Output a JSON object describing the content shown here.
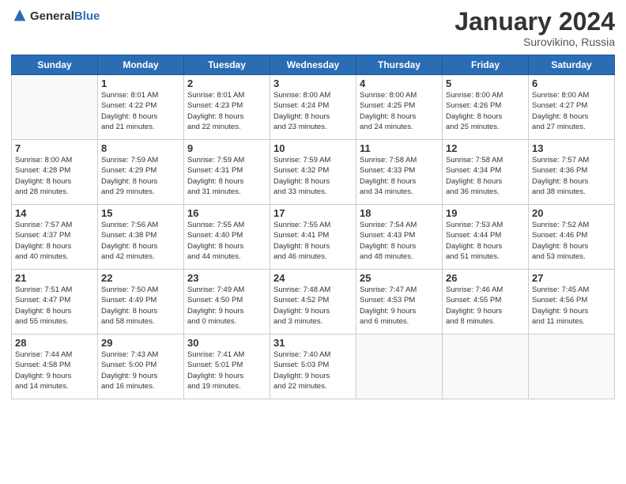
{
  "header": {
    "logo_general": "General",
    "logo_blue": "Blue",
    "month_title": "January 2024",
    "location": "Surovikino, Russia"
  },
  "days_of_week": [
    "Sunday",
    "Monday",
    "Tuesday",
    "Wednesday",
    "Thursday",
    "Friday",
    "Saturday"
  ],
  "weeks": [
    [
      {
        "day": "",
        "info": ""
      },
      {
        "day": "1",
        "info": "Sunrise: 8:01 AM\nSunset: 4:22 PM\nDaylight: 8 hours\nand 21 minutes."
      },
      {
        "day": "2",
        "info": "Sunrise: 8:01 AM\nSunset: 4:23 PM\nDaylight: 8 hours\nand 22 minutes."
      },
      {
        "day": "3",
        "info": "Sunrise: 8:00 AM\nSunset: 4:24 PM\nDaylight: 8 hours\nand 23 minutes."
      },
      {
        "day": "4",
        "info": "Sunrise: 8:00 AM\nSunset: 4:25 PM\nDaylight: 8 hours\nand 24 minutes."
      },
      {
        "day": "5",
        "info": "Sunrise: 8:00 AM\nSunset: 4:26 PM\nDaylight: 8 hours\nand 25 minutes."
      },
      {
        "day": "6",
        "info": "Sunrise: 8:00 AM\nSunset: 4:27 PM\nDaylight: 8 hours\nand 27 minutes."
      }
    ],
    [
      {
        "day": "7",
        "info": "Sunrise: 8:00 AM\nSunset: 4:28 PM\nDaylight: 8 hours\nand 28 minutes."
      },
      {
        "day": "8",
        "info": "Sunrise: 7:59 AM\nSunset: 4:29 PM\nDaylight: 8 hours\nand 29 minutes."
      },
      {
        "day": "9",
        "info": "Sunrise: 7:59 AM\nSunset: 4:31 PM\nDaylight: 8 hours\nand 31 minutes."
      },
      {
        "day": "10",
        "info": "Sunrise: 7:59 AM\nSunset: 4:32 PM\nDaylight: 8 hours\nand 33 minutes."
      },
      {
        "day": "11",
        "info": "Sunrise: 7:58 AM\nSunset: 4:33 PM\nDaylight: 8 hours\nand 34 minutes."
      },
      {
        "day": "12",
        "info": "Sunrise: 7:58 AM\nSunset: 4:34 PM\nDaylight: 8 hours\nand 36 minutes."
      },
      {
        "day": "13",
        "info": "Sunrise: 7:57 AM\nSunset: 4:36 PM\nDaylight: 8 hours\nand 38 minutes."
      }
    ],
    [
      {
        "day": "14",
        "info": "Sunrise: 7:57 AM\nSunset: 4:37 PM\nDaylight: 8 hours\nand 40 minutes."
      },
      {
        "day": "15",
        "info": "Sunrise: 7:56 AM\nSunset: 4:38 PM\nDaylight: 8 hours\nand 42 minutes."
      },
      {
        "day": "16",
        "info": "Sunrise: 7:55 AM\nSunset: 4:40 PM\nDaylight: 8 hours\nand 44 minutes."
      },
      {
        "day": "17",
        "info": "Sunrise: 7:55 AM\nSunset: 4:41 PM\nDaylight: 8 hours\nand 46 minutes."
      },
      {
        "day": "18",
        "info": "Sunrise: 7:54 AM\nSunset: 4:43 PM\nDaylight: 8 hours\nand 48 minutes."
      },
      {
        "day": "19",
        "info": "Sunrise: 7:53 AM\nSunset: 4:44 PM\nDaylight: 8 hours\nand 51 minutes."
      },
      {
        "day": "20",
        "info": "Sunrise: 7:52 AM\nSunset: 4:46 PM\nDaylight: 8 hours\nand 53 minutes."
      }
    ],
    [
      {
        "day": "21",
        "info": "Sunrise: 7:51 AM\nSunset: 4:47 PM\nDaylight: 8 hours\nand 55 minutes."
      },
      {
        "day": "22",
        "info": "Sunrise: 7:50 AM\nSunset: 4:49 PM\nDaylight: 8 hours\nand 58 minutes."
      },
      {
        "day": "23",
        "info": "Sunrise: 7:49 AM\nSunset: 4:50 PM\nDaylight: 9 hours\nand 0 minutes."
      },
      {
        "day": "24",
        "info": "Sunrise: 7:48 AM\nSunset: 4:52 PM\nDaylight: 9 hours\nand 3 minutes."
      },
      {
        "day": "25",
        "info": "Sunrise: 7:47 AM\nSunset: 4:53 PM\nDaylight: 9 hours\nand 6 minutes."
      },
      {
        "day": "26",
        "info": "Sunrise: 7:46 AM\nSunset: 4:55 PM\nDaylight: 9 hours\nand 8 minutes."
      },
      {
        "day": "27",
        "info": "Sunrise: 7:45 AM\nSunset: 4:56 PM\nDaylight: 9 hours\nand 11 minutes."
      }
    ],
    [
      {
        "day": "28",
        "info": "Sunrise: 7:44 AM\nSunset: 4:58 PM\nDaylight: 9 hours\nand 14 minutes."
      },
      {
        "day": "29",
        "info": "Sunrise: 7:43 AM\nSunset: 5:00 PM\nDaylight: 9 hours\nand 16 minutes."
      },
      {
        "day": "30",
        "info": "Sunrise: 7:41 AM\nSunset: 5:01 PM\nDaylight: 9 hours\nand 19 minutes."
      },
      {
        "day": "31",
        "info": "Sunrise: 7:40 AM\nSunset: 5:03 PM\nDaylight: 9 hours\nand 22 minutes."
      },
      {
        "day": "",
        "info": ""
      },
      {
        "day": "",
        "info": ""
      },
      {
        "day": "",
        "info": ""
      }
    ]
  ]
}
